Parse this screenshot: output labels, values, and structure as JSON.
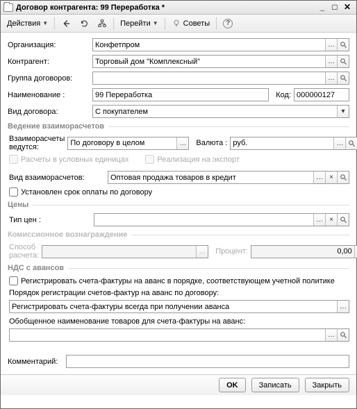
{
  "window": {
    "title": "Договор контрагента: 99 Переработка *"
  },
  "toolbar": {
    "actions": "Действия",
    "goto": "Перейти",
    "tips": "Советы"
  },
  "labels": {
    "org": "Организация:",
    "counterparty": "Контрагент:",
    "group": "Группа договоров:",
    "name": "Наименование :",
    "code": "Код:",
    "kind": "Вид договора:"
  },
  "fields": {
    "org": "Конфетпром",
    "counterparty": "Торговый дом \"Комплексный\"",
    "group": "",
    "name": "99 Переработка",
    "code": "000000127",
    "kind": "С покупателем"
  },
  "settlements": {
    "title": "Ведение взаиморасчетов",
    "by_label": "Взаиморасчеты ведутся:",
    "by_value": "По договору в целом",
    "currency_label": "Валюта :",
    "currency_value": "руб.",
    "usl_units": "Расчеты в условных единицах",
    "export": "Реализация на экспорт",
    "mutual_kind_label": "Вид взаиморасчетов:",
    "mutual_kind_value": "Оптовая продажа товаров в кредит",
    "due_set": "Установлен срок оплаты по договору"
  },
  "prices": {
    "title": "Цены",
    "type_label": "Тип цен :",
    "type_value": ""
  },
  "commission": {
    "title": "Комиссионное вознаграждение",
    "method_label": "Способ расчета:",
    "method_value": "",
    "percent_label": "Процент:",
    "percent_value": "0,00"
  },
  "vat": {
    "title": "НДС с авансов",
    "register_cb": "Регистрировать счета-фактуры на аванс в порядке, соответствующем учетной политике",
    "order_label": "Порядок регистрации счетов-фактур на аванс по договору:",
    "order_value": "Регистрировать счета-фактуры всегда при получении аванса",
    "generic_label": "Обобщенное наименование товаров для счета-фактуры на аванс:",
    "generic_value": ""
  },
  "comment": {
    "label": "Комментарий:",
    "value": ""
  },
  "footer": {
    "ok": "OK",
    "save": "Записать",
    "close": "Закрыть"
  },
  "glyphs": {
    "ellipsis": "…",
    "magnifier": "🔍",
    "cross": "×",
    "dropdown": "▾",
    "bullet": "▾"
  }
}
